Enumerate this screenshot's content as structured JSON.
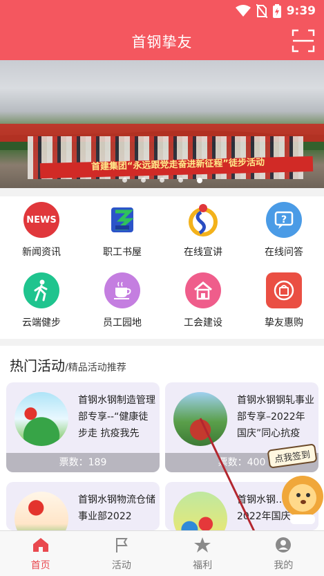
{
  "status_bar": {
    "time": "9:39"
  },
  "header": {
    "title": "首钢挚友"
  },
  "banner": {
    "caption": "首建集团“永远跟党走奋进新征程”徒步活动",
    "slide_count": 5,
    "active_slide": 5
  },
  "menu": {
    "items": [
      {
        "label": "新闻资讯",
        "icon": "news-icon",
        "badge_text": "NEWS"
      },
      {
        "label": "职工书屋",
        "icon": "book-house-icon"
      },
      {
        "label": "在线宣讲",
        "icon": "lecture-icon"
      },
      {
        "label": "在线问答",
        "icon": "question-icon"
      },
      {
        "label": "云端健步",
        "icon": "walking-icon"
      },
      {
        "label": "员工园地",
        "icon": "coffee-icon"
      },
      {
        "label": "工会建设",
        "icon": "house-icon"
      },
      {
        "label": "挚友惠购",
        "icon": "shopping-icon"
      }
    ]
  },
  "hot": {
    "title": "热门活动",
    "separator": "/",
    "subtitle": "精品活动推荐",
    "cards": [
      {
        "text": "首钢水钢制造管理部专享--“健康徒步走 抗疫我先",
        "votes_label": "票数：189"
      },
      {
        "text": "首钢水钢钢轧事业部专享–2022年国庆”同心抗疫",
        "votes_label": "票数：400"
      },
      {
        "text": "首钢水钢物流仓储事业部2022",
        "votes_label": ""
      },
      {
        "text": "首钢水钢…心2022年国庆",
        "votes_label": ""
      }
    ]
  },
  "mascot": {
    "tag": "点我签到"
  },
  "tabs": [
    {
      "label": "首页",
      "icon": "home-icon",
      "active": true
    },
    {
      "label": "活动",
      "icon": "flag-icon",
      "active": false
    },
    {
      "label": "福利",
      "icon": "star-icon",
      "active": false
    },
    {
      "label": "我的",
      "icon": "profile-icon",
      "active": false
    }
  ],
  "colors": {
    "brand": "#f4575f",
    "tab_active": "#e9494f"
  }
}
